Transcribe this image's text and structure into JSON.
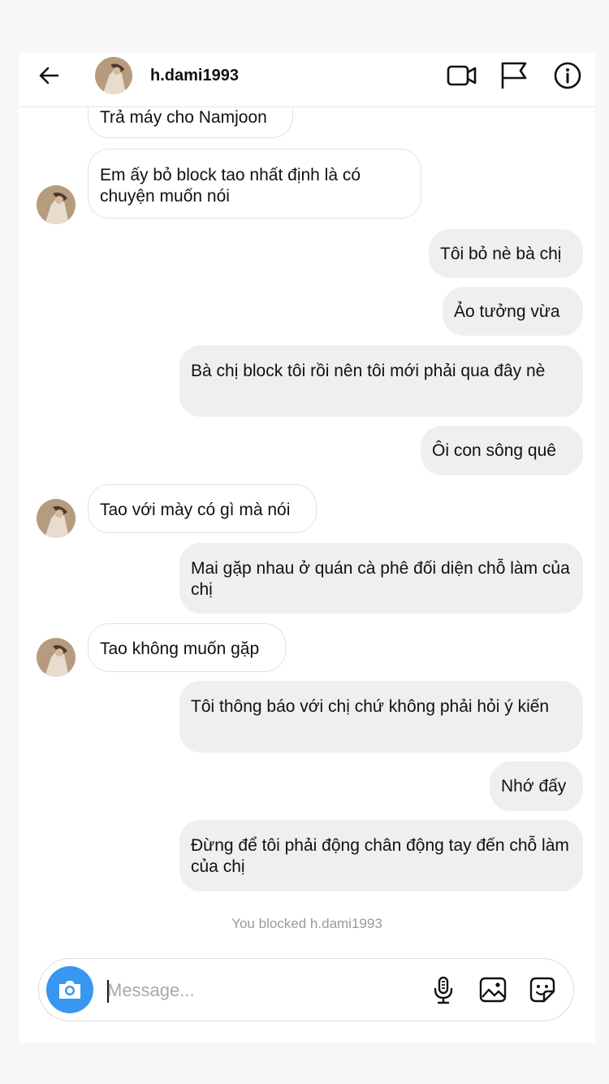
{
  "header": {
    "username": "h.dami1993"
  },
  "messages": [
    {
      "side": "in",
      "text": "Trả máy cho Namjoon"
    },
    {
      "side": "in",
      "text": "Em ấy bỏ block tao nhất định là có chuyện muốn nói"
    },
    {
      "side": "out",
      "text": "Tôi bỏ nè bà chị"
    },
    {
      "side": "out",
      "text": "Ảo tưởng vừa"
    },
    {
      "side": "out",
      "text": "Bà chị block tôi rồi nên tôi mới phải qua đây nè"
    },
    {
      "side": "out",
      "text": "Ôi con sông quê"
    },
    {
      "side": "in",
      "text": "Tao với mày có gì mà nói"
    },
    {
      "side": "out",
      "text": "Mai gặp nhau ở quán cà phê đối diện chỗ làm của chị"
    },
    {
      "side": "in",
      "text": "Tao không muốn gặp"
    },
    {
      "side": "out",
      "text": "Tôi thông báo với chị chứ không phải hỏi ý kiến"
    },
    {
      "side": "out",
      "text": "Nhớ đấy"
    },
    {
      "side": "out",
      "text": "Đừng để tôi phải động chân động tay đến chỗ làm của chị"
    }
  ],
  "blocked_notice": "You blocked h.dami1993",
  "composer": {
    "placeholder": "Message..."
  },
  "icons": {
    "back": "arrow-left-icon",
    "video": "video-call-icon",
    "flag": "flag-icon",
    "info": "info-icon",
    "camera": "camera-icon",
    "mic": "microphone-icon",
    "gallery": "gallery-icon",
    "sticker": "sticker-icon"
  },
  "colors": {
    "accent": "#3897f0",
    "incoming_bubble": "#ffffff",
    "outgoing_bubble": "#efefef"
  }
}
